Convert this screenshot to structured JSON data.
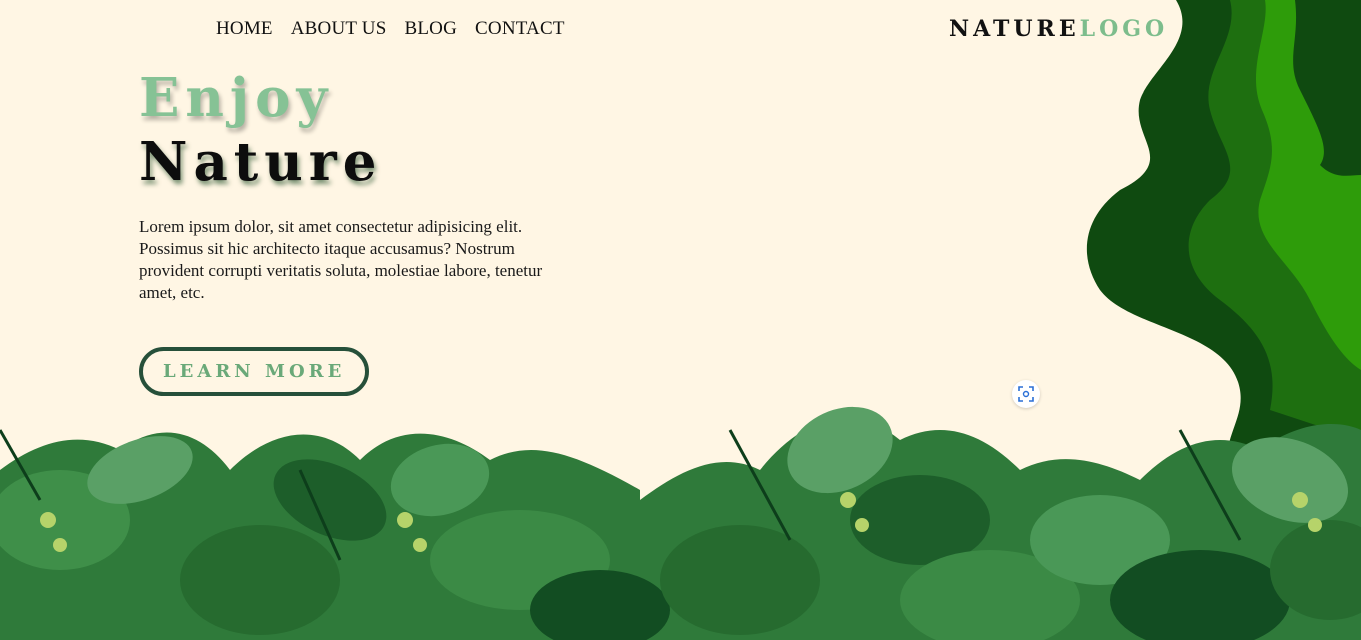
{
  "nav": {
    "items": [
      {
        "label": "HOME"
      },
      {
        "label": "ABOUT US"
      },
      {
        "label": "BLOG"
      },
      {
        "label": "CONTACT"
      }
    ]
  },
  "logo": {
    "part1": "NATURE",
    "part2": "LOGO"
  },
  "hero": {
    "title_line1": "Enjoy",
    "title_line2": "Nature",
    "description": "Lorem ipsum dolor, sit amet consectetur adipisicing elit. Possimus sit hic architecto itaque accusamus? Nostrum provident corrupti veritatis soluta, molestiae labore, tenetur amet, etc.",
    "cta_label": "LEARN MORE"
  },
  "colors": {
    "background": "#fff6e4",
    "accent_light_green": "#86c295",
    "button_border": "#26503a",
    "dark_green": "#0f4a10",
    "mid_green": "#1f7a12",
    "bright_green": "#2e9c0a"
  },
  "icons": {
    "scan": "scan-icon"
  }
}
